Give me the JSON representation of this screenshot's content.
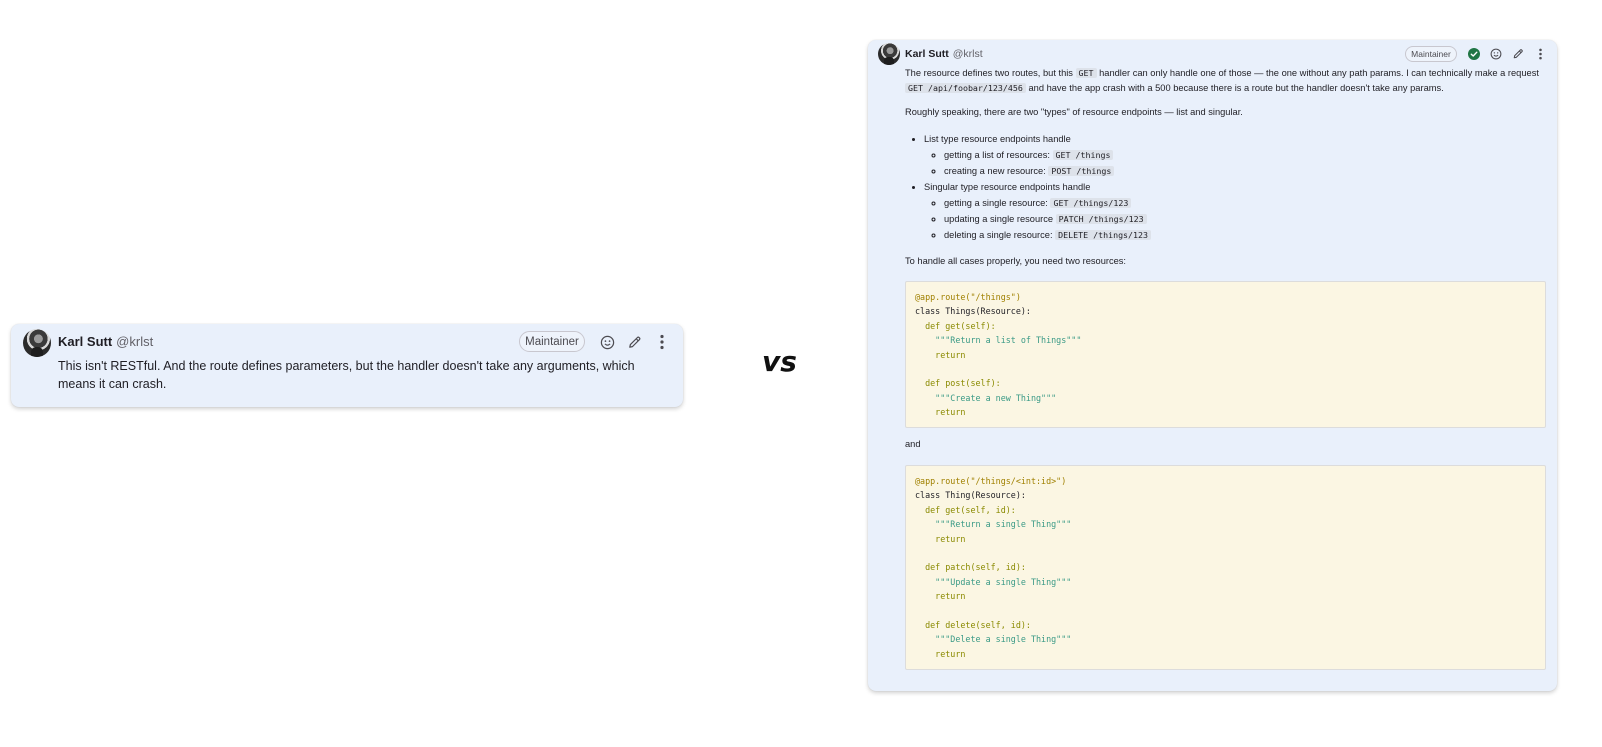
{
  "left_card": {
    "author": "Karl Sutt",
    "handle": "@krlst",
    "badge": "Maintainer",
    "body": "This isn't RESTful. And the route defines parameters, but the handler doesn't take any arguments, which means it can crash."
  },
  "separator": "vs",
  "right_card": {
    "author": "Karl Sutt",
    "handle": "@krlst",
    "badge": "Maintainer",
    "p1_a": "The resource defines two routes, but this ",
    "p1_code1": "GET",
    "p1_b": " handler can only handle one of those — the one without any path params. I can technically make a request ",
    "p1_code2": "GET /api/foobar/123/456",
    "p1_c": " and have the app crash with a 500 because there is a route but the handler doesn't take any params.",
    "p2": "Roughly speaking, there are two \"types\" of resource endpoints — list and singular.",
    "list": [
      {
        "label": "List type resource endpoints handle",
        "items": [
          {
            "text": "getting a list of resources: ",
            "code": "GET /things"
          },
          {
            "text": "creating a new resource: ",
            "code": "POST /things"
          }
        ]
      },
      {
        "label": "Singular type resource endpoints handle",
        "items": [
          {
            "text": "getting a single resource: ",
            "code": "GET /things/123"
          },
          {
            "text": "updating a single resource ",
            "code": "PATCH /things/123"
          },
          {
            "text": "deleting a single resource: ",
            "code": "DELETE /things/123"
          }
        ]
      }
    ],
    "p3": "To handle all cases properly, you need two resources:",
    "and": "and",
    "code1": {
      "route": "@app.route(\"/things\")",
      "class_line": "class Things(Resource):",
      "get_def": "def get(self):",
      "get_doc": "\"\"\"Return a list of Things\"\"\"",
      "ret": "return",
      "post_def": "def post(self):",
      "post_doc": "\"\"\"Create a new Thing\"\"\""
    },
    "code2": {
      "route": "@app.route(\"/things/<int:id>\")",
      "class_line": "class Thing(Resource):",
      "get_def": "def get(self, id):",
      "get_doc": "\"\"\"Return a single Thing\"\"\"",
      "ret": "return",
      "patch_def": "def patch(self, id):",
      "patch_doc": "\"\"\"Update a single Thing\"\"\"",
      "delete_def": "def delete(self, id):",
      "delete_doc": "\"\"\"Delete a single Thing\"\"\""
    }
  },
  "icons": [
    "emoji-icon",
    "pencil-icon",
    "more-options-icon",
    "resolved-check-icon"
  ],
  "colors": {
    "card_bg": "#e9f0fb",
    "code_bg": "#fbf6e3",
    "check_green": "#217645"
  }
}
